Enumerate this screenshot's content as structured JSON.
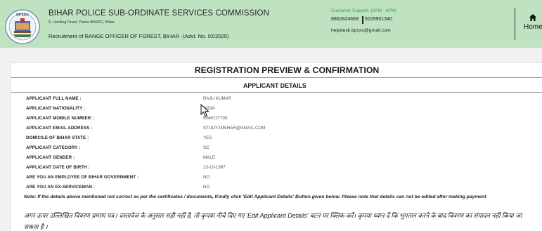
{
  "header": {
    "logo_text": "BPSSC",
    "org_title": "BIHAR POLICE SUB-ORDINATE SERVICES COMMISSION",
    "org_address": "5, Harding Road, Patna-800001, Bihar",
    "recruitment": "Recruitment of RANGE OFFICER OF FOREST, BIHAR -(Advt. No. 02/2025)",
    "support_title": "Customer Support: (9AM - 6PM)",
    "support_phone1": "8862824669",
    "support_phone2": "9229901340",
    "support_email": "helpdesk.bpssc@gmail.com",
    "home_label": "Home",
    "home_icon": "home-icon"
  },
  "main": {
    "title": "REGISTRATION PREVIEW & CONFIRMATION",
    "section_title": "APPLICANT DETAILS",
    "details": [
      {
        "label": "APPLICANT FULL NAME :",
        "value": "RAJU KUMAR"
      },
      {
        "label": "APPLICANT NATIONALITY :",
        "value": "INDIA"
      },
      {
        "label": "APPLICANT MOBILE NUMBER :",
        "value": "9546727700"
      },
      {
        "label": "APPLICANT EMAIL ADDRESS :",
        "value": "STUDY24BIHAR@GMAIL.COM"
      },
      {
        "label": "DOMICILE OF BIHAR STATE :",
        "value": "YES"
      },
      {
        "label": "APPLICANT CATEGORY :",
        "value": "SC"
      },
      {
        "label": "APPLICANT GENDER :",
        "value": "MALE"
      },
      {
        "label": "APPLICANT DATE OF BIRTH :",
        "value": "23-10-1997"
      },
      {
        "label": "ARE YOU AN EMPLOYEE OF BIHAR GOVERNMENT :",
        "value": "NO"
      },
      {
        "label": "ARE YOU AN EX-SERVICEMAN :",
        "value": "NO"
      }
    ],
    "note_en": "Note: If the details above mentioned not correct as per the certificates / documents, Kindly click 'Edit Applicant Details' Button given below. Please note that details can not be edited after making payment",
    "note_hi": "अगर ऊपर उल्लिखित विवरण प्रमाण पत्र / दस्तावेज के अनुसार सही नहीं है, तो कृपया नीचे दिए गए 'Edit Applicant Details' बटन पर क्लिक करें। कृपया ध्यान दें कि भुगतान करने के बाद विवरण का संपादन नहीं किया जा सकता है ।"
  },
  "colors": {
    "header_bg": "#bfe3c0",
    "support_green": "#2fa84b"
  }
}
